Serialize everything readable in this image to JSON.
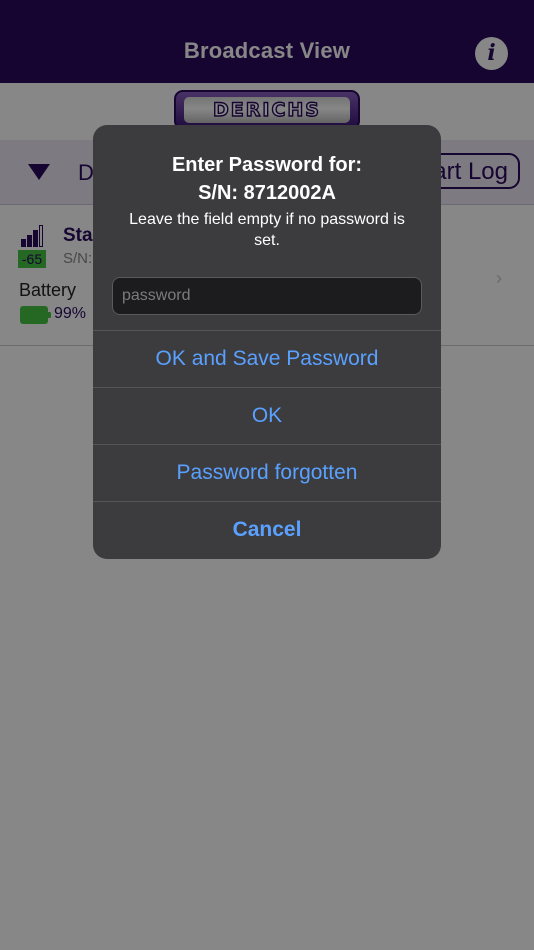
{
  "navbar": {
    "title": "Broadcast View",
    "info_icon": "info-icon"
  },
  "logo": {
    "text": "DERICHS"
  },
  "toolbar": {
    "dropdown_icon": "triangle-down-icon",
    "label": "D",
    "start_log_label": "art Log"
  },
  "device": {
    "name": "Sta",
    "serial": "S/N:",
    "rssi": "-65",
    "signal_icon": "signal-bars-icon",
    "battery_label": "Battery",
    "battery_percent": "99%",
    "battery_icon": "battery-icon",
    "chevron": "›"
  },
  "alert": {
    "title": "Enter Password for:",
    "serial": "S/N: 8712002A",
    "message": "Leave the field empty if no password is set.",
    "field_placeholder": "password",
    "field_value": "",
    "buttons": [
      {
        "label": "OK and Save Password"
      },
      {
        "label": "OK"
      },
      {
        "label": "Password forgotten"
      },
      {
        "label": "Cancel"
      }
    ]
  },
  "colors": {
    "navbar": "#2a0a5e",
    "accent_green": "#44c442",
    "alert_button_text": "#5aa0ff",
    "alert_background": "#3c3c3e"
  }
}
